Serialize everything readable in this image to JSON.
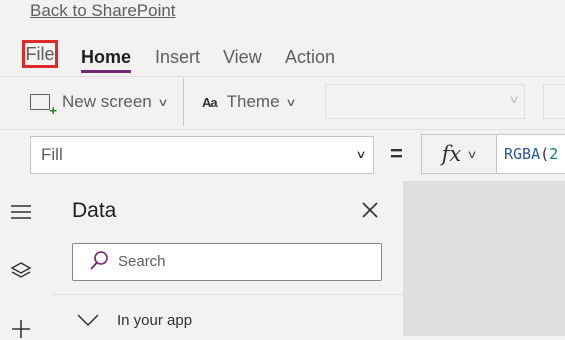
{
  "top": {
    "back_link": "Back to SharePoint"
  },
  "menu": {
    "tabs": [
      {
        "label": "File"
      },
      {
        "label": "Home"
      },
      {
        "label": "Insert"
      },
      {
        "label": "View"
      },
      {
        "label": "Action"
      }
    ]
  },
  "toolbar": {
    "new_screen_label": "New screen",
    "theme_label": "Theme",
    "theme_icon_text": "Aa"
  },
  "formula_bar": {
    "property_value": "Fill",
    "equals": "=",
    "fx_label": "fx",
    "formula_func": "RGBA",
    "formula_paren": "(",
    "formula_arg": "2"
  },
  "data_pane": {
    "title": "Data",
    "search_placeholder": "Search",
    "section_label": "In your app"
  },
  "colors": {
    "accent": "#742774",
    "highlight_box": "#e02a2a",
    "formula_function": "#2b579a"
  },
  "icons": {
    "new_screen": "new-screen-icon",
    "theme": "theme-icon",
    "fx": "fx-icon",
    "hamburger": "hamburger-icon",
    "layers": "layers-icon",
    "add": "plus-icon",
    "close": "close-icon",
    "search": "search-icon",
    "chevron": "chevron-down-icon"
  }
}
